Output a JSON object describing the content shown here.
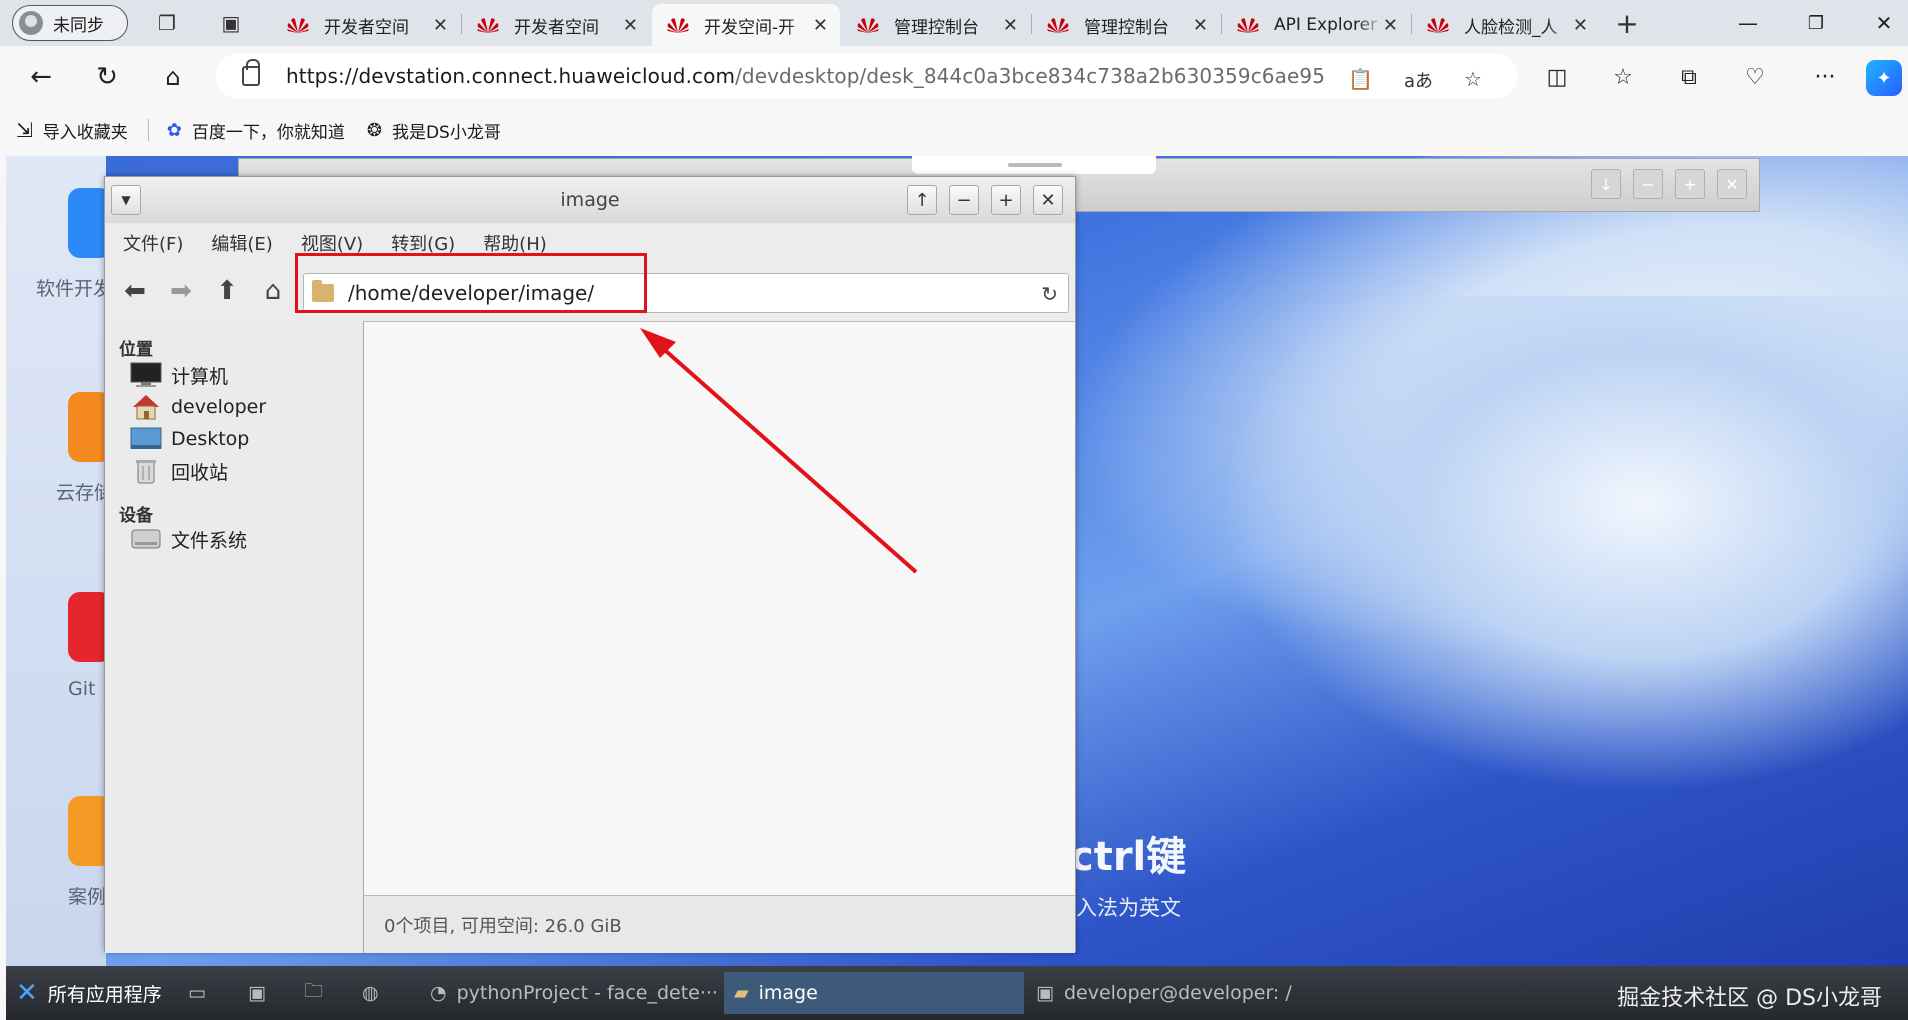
{
  "browser": {
    "profile_label": "未同步",
    "tabs": [
      {
        "title": "开发者空间"
      },
      {
        "title": "开发者空间"
      },
      {
        "title": "开发空间-开"
      },
      {
        "title": "管理控制台"
      },
      {
        "title": "管理控制台"
      },
      {
        "title": "API Explorer"
      },
      {
        "title": "人脸检测_人"
      }
    ],
    "url_host": "https://devstation.connect.huaweicloud.com",
    "url_path": "/devdesktop/desk_844c0a3bce834c738a2b630359c6ae95",
    "bookmarks": [
      "导入收藏夹",
      "百度一下，你就知道",
      "我是DS小龙哥"
    ]
  },
  "desktop": {
    "icons": [
      "软件开发",
      "云存储",
      "Git",
      "案例"
    ],
    "background_text_1": "ctrl键",
    "background_text_2": "入法为英文"
  },
  "file_manager": {
    "title": "image",
    "menu": [
      "文件(F)",
      "编辑(E)",
      "视图(V)",
      "转到(G)",
      "帮助(H)"
    ],
    "location": "/home/developer/image/",
    "places_heading": "位置",
    "places": [
      "计算机",
      "developer",
      "Desktop",
      "回收站"
    ],
    "devices_heading": "设备",
    "devices": [
      "文件系统"
    ],
    "status": "0个项目, 可用空间: 26.0 GiB"
  },
  "taskbar": {
    "start_label": "所有应用程序",
    "tasks": [
      "pythonProject - face_dete···",
      "image",
      "developer@developer: /"
    ],
    "watermark": "掘金技术社区 @ DS小龙哥"
  },
  "colors": {
    "highlight": "#e3121a",
    "huawei_red": "#c7000b"
  }
}
